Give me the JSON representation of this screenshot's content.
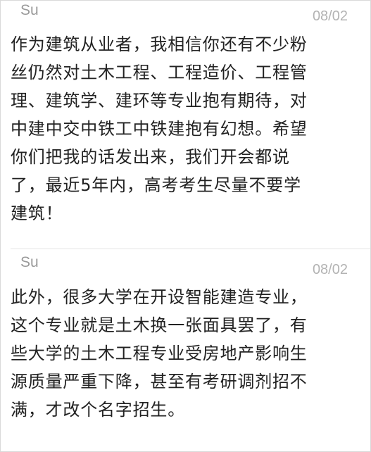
{
  "comments": [
    {
      "author": "Su",
      "date": "08/02",
      "text": "作为建筑从业者，我相信你还有不少粉\n丝仍然对土木工程、工程造价、工程管\n理、建筑学、建环等专业抱有期待，对\n中建中交中铁工中铁建抱有幻想。希望\n你们把我的话发出来，我们开会都说\n了，最近5年内，高考考生尽量不要学\n建筑！"
    },
    {
      "author": "Su",
      "date": "08/02",
      "text": "此外，很多大学在开设智能建造专业，\n这个专业就是土木换一张面具罢了，有\n些大学的土木工程专业受房地产影响生\n源质量严重下降，甚至有考研调剂招不\n满，才改个名字招生。"
    }
  ]
}
